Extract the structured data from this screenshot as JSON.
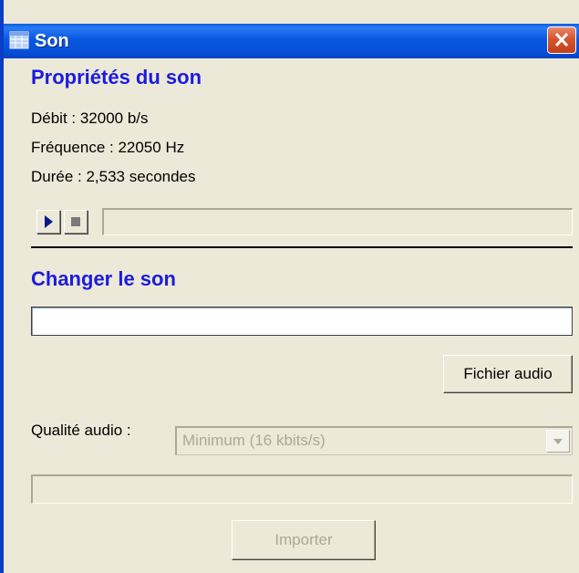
{
  "window": {
    "title": "Son",
    "icons": {
      "app": "grid-window-icon",
      "close": "close-x-icon"
    }
  },
  "properties": {
    "heading": "Propriétés du son",
    "bitrate": "Débit : 32000 b/s",
    "frequency": "Fréquence : 22050 Hz",
    "duration": "Durée : 2,533 secondes",
    "player": {
      "play_icon": "play-icon",
      "stop_icon": "stop-icon",
      "progress": 0
    }
  },
  "change": {
    "heading": "Changer le son",
    "path_value": "",
    "browse_button": "Fichier audio"
  },
  "quality": {
    "label": "Qualité audio :",
    "selected": "Minimum (16 kbits/s)",
    "enabled": false
  },
  "import": {
    "progress": 0,
    "button": "Importer",
    "enabled": false
  },
  "colors": {
    "titlebar": "#0A58E0",
    "heading": "#1B1BE0",
    "face": "#ECE9D8",
    "close": "#D4552F",
    "disabled_text": "#ACA899"
  }
}
